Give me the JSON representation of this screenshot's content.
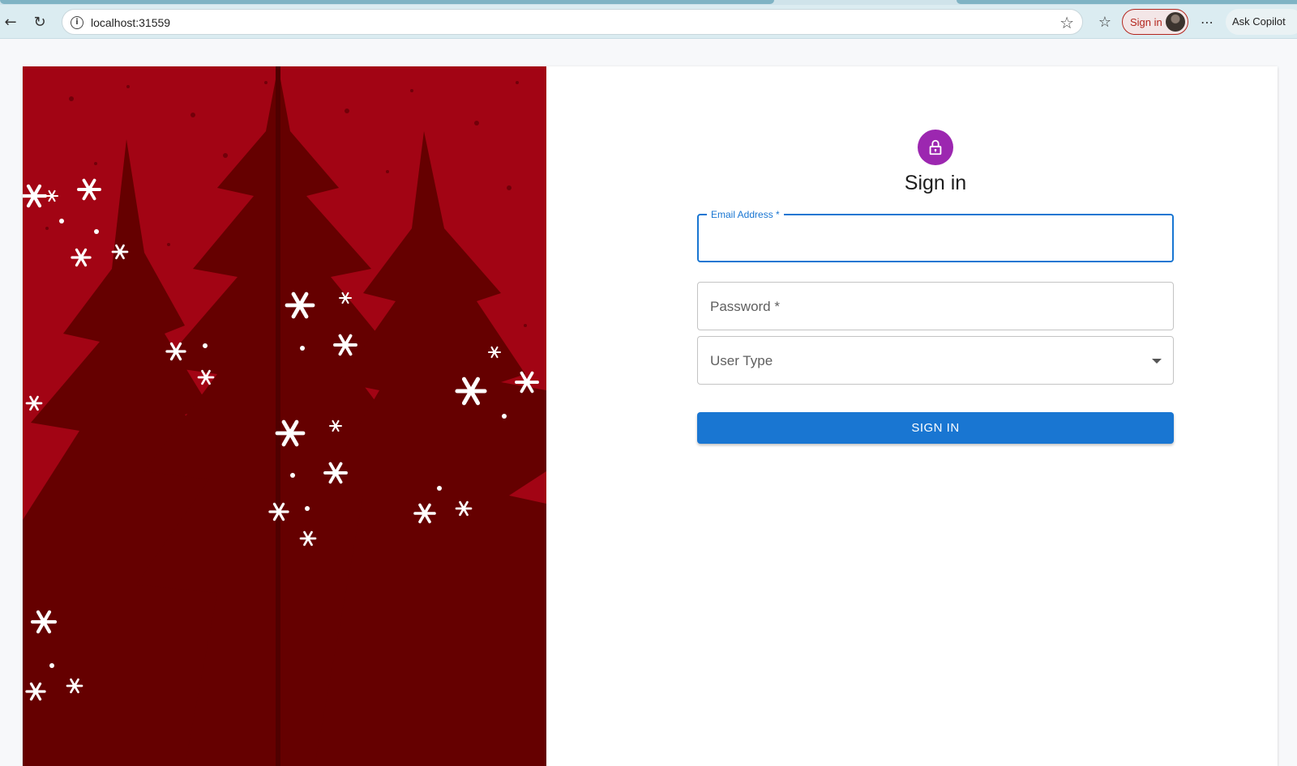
{
  "browser": {
    "url": "localhost:31559",
    "profile_button": "Sign in",
    "copilot_button": "Ask Copilot",
    "icons": [
      "back-icon",
      "reload-icon",
      "info-icon",
      "favorite-star-icon",
      "favorites-icon",
      "profile-avatar",
      "more-icon"
    ]
  },
  "hero": {
    "background_color": "#a20414",
    "tree_color": "#650000",
    "snow_color": "#ffffff"
  },
  "form": {
    "title": "Sign in",
    "email_label": "Email Address *",
    "password_placeholder": "Password *",
    "user_type_placeholder": "User Type",
    "submit_label": "SIGN IN",
    "accent_color": "#1976d2",
    "avatar_color": "#9c27b0"
  }
}
